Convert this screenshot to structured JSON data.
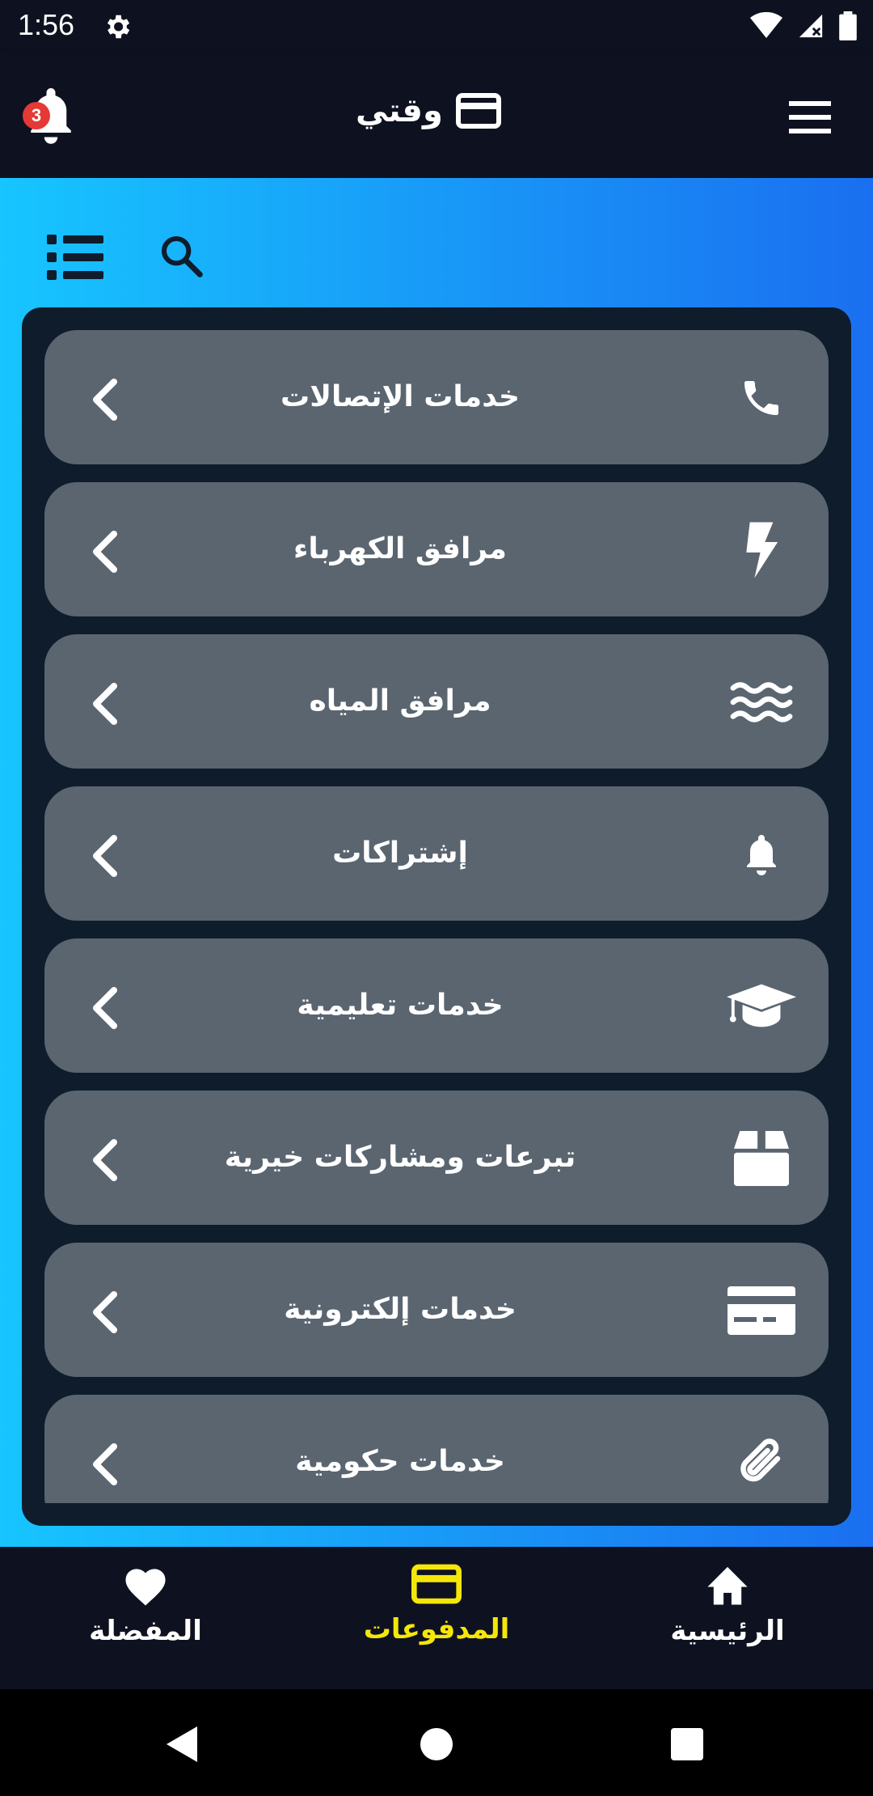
{
  "status_bar": {
    "time": "1:56"
  },
  "app_bar": {
    "title": "وقتي",
    "notification_count": "3"
  },
  "categories": [
    {
      "label": "خدمات الإتصالات",
      "icon": "phone-icon"
    },
    {
      "label": "مرافق الكهرباء",
      "icon": "lightning-icon"
    },
    {
      "label": "مرافق المياه",
      "icon": "water-icon"
    },
    {
      "label": "إشتراكات",
      "icon": "bell-icon"
    },
    {
      "label": "خدمات تعليمية",
      "icon": "graduation-cap-icon"
    },
    {
      "label": "تبرعات ومشاركات خيرية",
      "icon": "box-icon"
    },
    {
      "label": "خدمات إلكترونية",
      "icon": "credit-card-icon"
    },
    {
      "label": "خدمات حكومية",
      "icon": "paperclip-icon"
    }
  ],
  "bottom_nav": [
    {
      "label": "المفضلة",
      "icon": "heart-icon"
    },
    {
      "label": "المدفوعات",
      "icon": "card-icon",
      "active": true
    },
    {
      "label": "الرئيسية",
      "icon": "home-icon"
    }
  ],
  "colors": {
    "bar_background": "#0e1220",
    "card_background": "#5a6570",
    "panel_background": "#0e1c2c",
    "active_nav": "#f5e60a",
    "badge": "#e53935",
    "gradient_start": "#17c5ff",
    "gradient_end": "#1a6ff0"
  }
}
